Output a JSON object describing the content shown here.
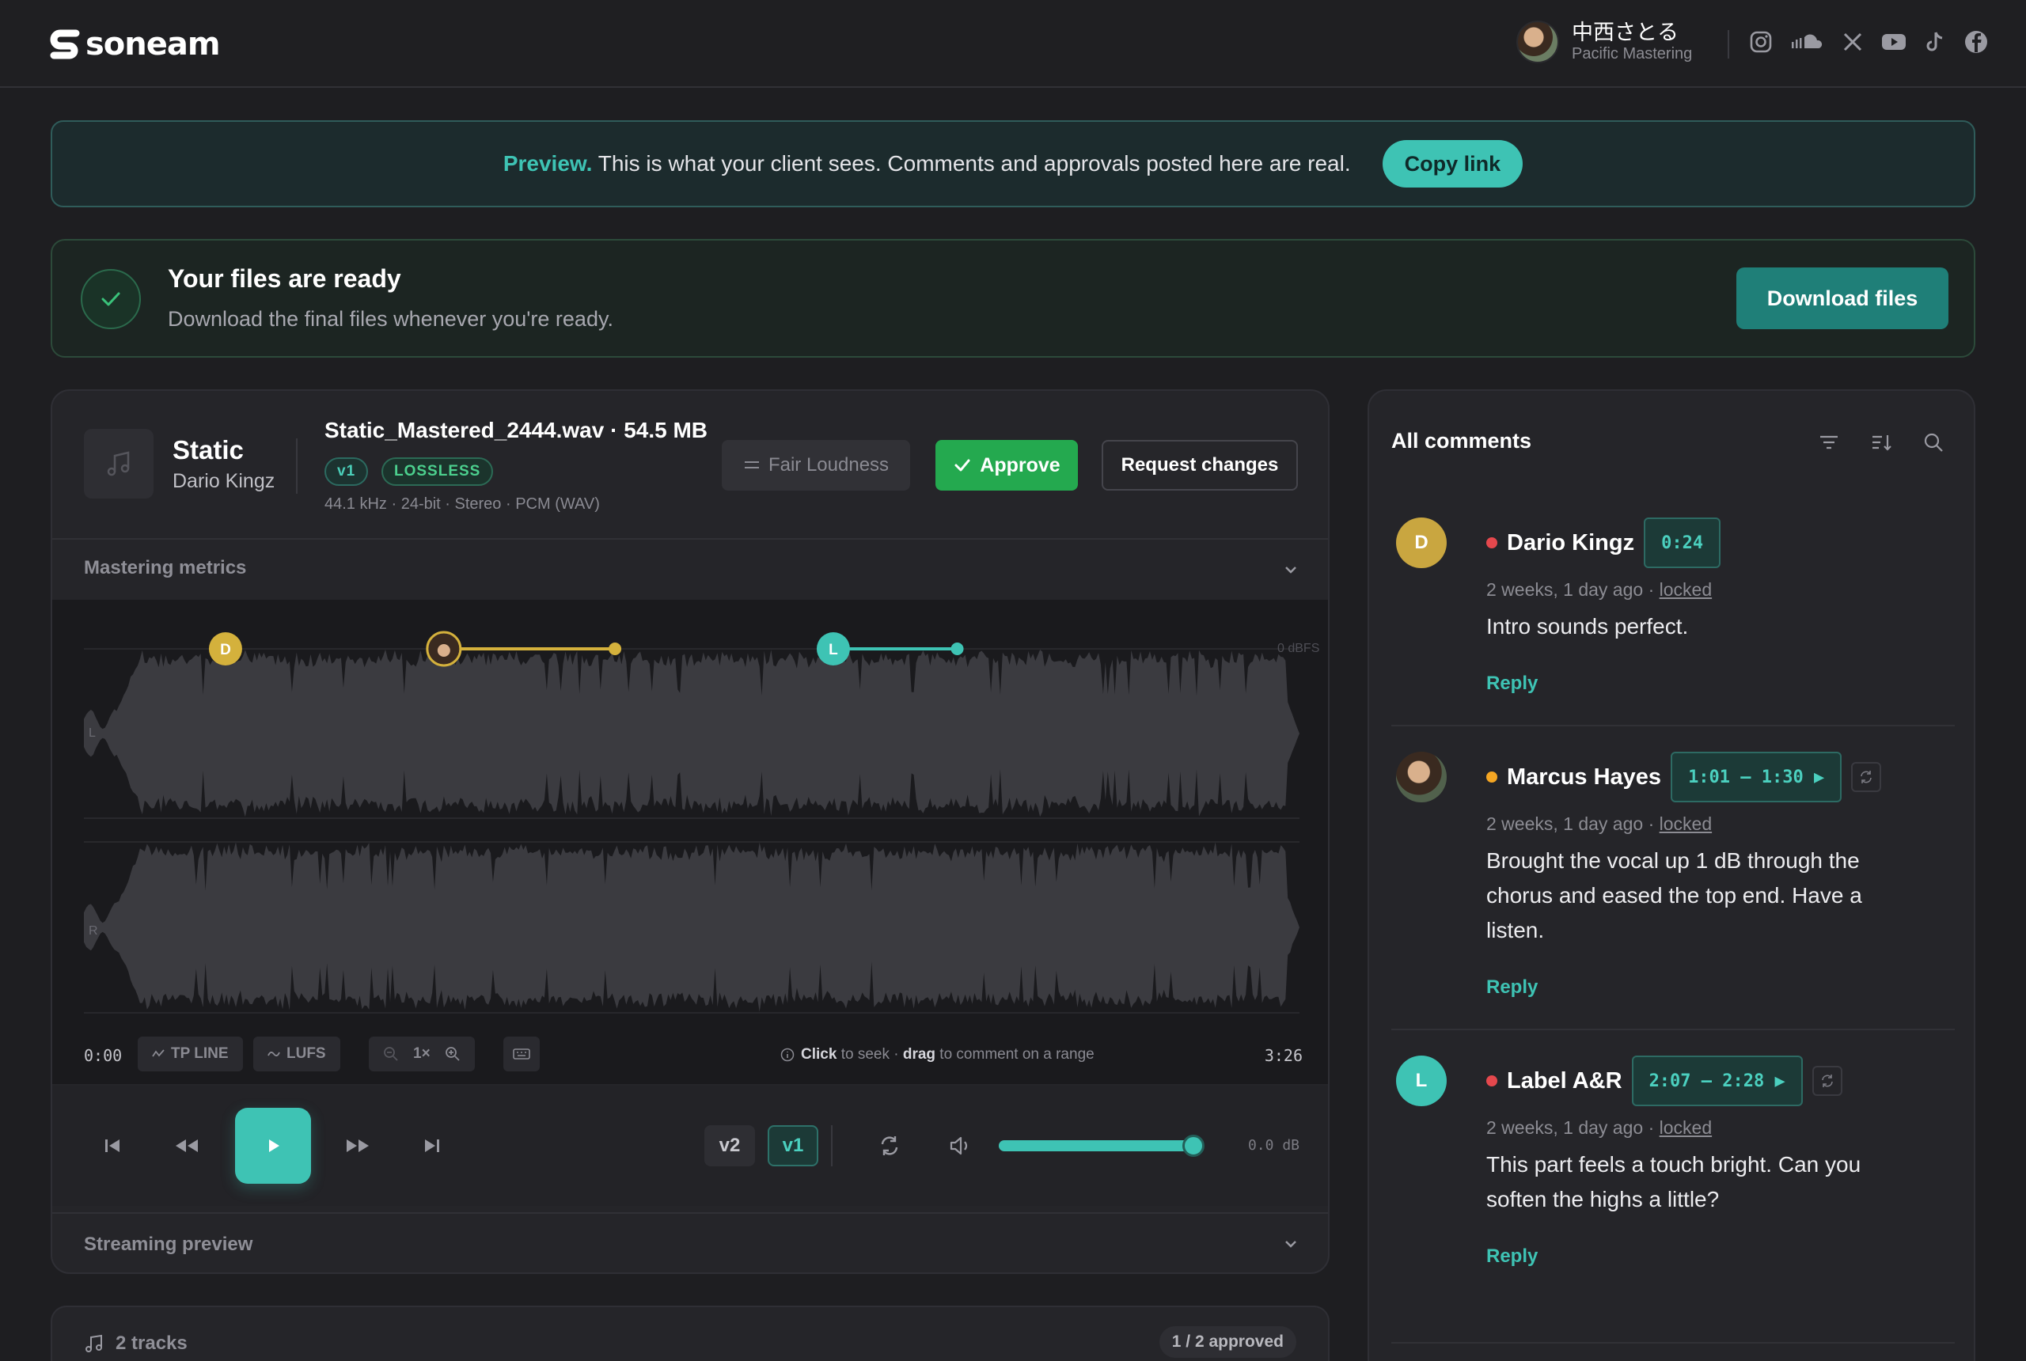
{
  "header": {
    "logo": "soneam",
    "user_name": "中西さとる",
    "user_studio": "Pacific Mastering",
    "socials": [
      "instagram-icon",
      "soundcloud-icon",
      "x-icon",
      "youtube-icon",
      "tiktok-icon",
      "facebook-icon"
    ]
  },
  "banner": {
    "strong": "Preview.",
    "text": "This is what your client sees. Comments and approvals posted here are real.",
    "copy_label": "Copy link"
  },
  "ready": {
    "title": "Your files are ready",
    "subtitle": "Download the final files whenever you're ready.",
    "download_label": "Download files"
  },
  "track": {
    "title": "Static",
    "artist": "Dario Kingz",
    "file": "Static_Mastered_2444.wav · 54.5 MB",
    "version_badge": "v1",
    "quality_badge": "LOSSLESS",
    "format": "44.1 kHz · 24-bit · Stereo · PCM (WAV)",
    "fair_loudness_label": "Fair Loudness",
    "approve_label": "Approve",
    "request_changes_label": "Request changes",
    "mastering_metrics_label": "Mastering metrics",
    "streaming_preview_label": "Streaming preview"
  },
  "waveform": {
    "db_label": "0 dBFS",
    "channel_left": "L",
    "channel_right": "R",
    "markers": [
      {
        "initial": "D",
        "color": "#d4b13c",
        "start": "0:24",
        "end": null
      },
      {
        "initial": "",
        "color": "#d4b13c",
        "start": "1:01",
        "end": "1:30"
      },
      {
        "initial": "L",
        "color": "#3ec3b4",
        "start": "2:07",
        "end": "2:28"
      }
    ],
    "start_time": "0:00",
    "end_time": "3:26",
    "tp_line_label": "TP LINE",
    "lufs_label": "LUFS",
    "zoom_label": "1×",
    "hint_click": "Click",
    "hint_mid": " to seek · ",
    "hint_drag": "drag",
    "hint_end": " to comment on a range"
  },
  "transport": {
    "versions": [
      "v2",
      "v1"
    ],
    "active_version": "v1",
    "volume_level": 1.0,
    "gain_label": "0.0 dB"
  },
  "tracks": {
    "count_label": "2 tracks",
    "approved_label": "1 / 2 approved"
  },
  "comments": {
    "title": "All comments",
    "items": [
      {
        "initial": "D",
        "avatar_color": "#c9a640",
        "name": "Dario Kingz",
        "status_color": "#e5484d",
        "timecode": "0:24",
        "meta_time": "2 weeks, 1 day ago · ",
        "meta_state": "locked",
        "body": "Intro sounds perfect.",
        "reply": "Reply"
      },
      {
        "initial": "",
        "avatar_color": "#3a2e26",
        "name": "Marcus Hayes",
        "status_color": "#f5a623",
        "timecode": "1:01 – 1:30 ▶",
        "meta_time": "2 weeks, 1 day ago · ",
        "meta_state": "locked",
        "body": "Brought the vocal up 1 dB through the chorus and eased the top end. Have a listen.",
        "reply": "Reply"
      },
      {
        "initial": "L",
        "avatar_color": "#3ec3b4",
        "name": "Label A&R",
        "status_color": "#e5484d",
        "timecode": "2:07 – 2:28 ▶",
        "meta_time": "2 weeks, 1 day ago · ",
        "meta_state": "locked",
        "body": "This part feels a touch bright. Can you soften the highs a little?",
        "reply": "Reply"
      }
    ]
  }
}
